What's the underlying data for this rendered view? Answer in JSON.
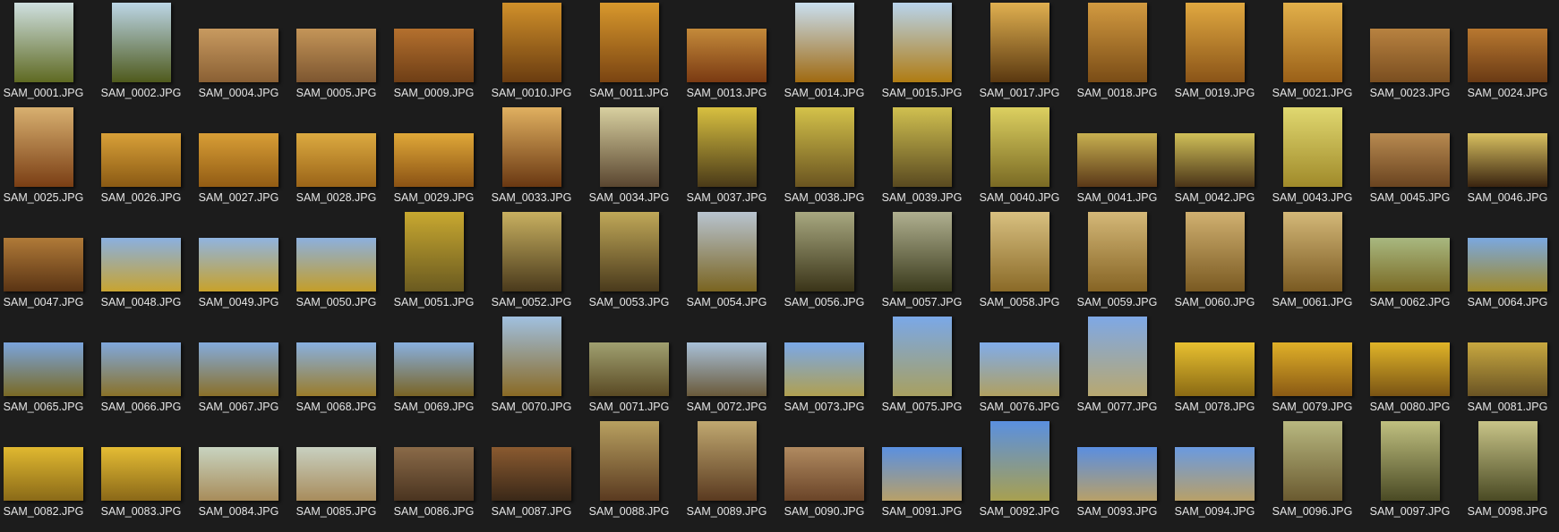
{
  "files": [
    [
      "SAM_0001.JPG",
      "p",
      "#cfe0e0",
      "#5f6a22"
    ],
    [
      "SAM_0002.JPG",
      "p",
      "#bcd6e6",
      "#4f5a1c"
    ],
    [
      "SAM_0004.JPG",
      "l",
      "#c89a60",
      "#8a6034"
    ],
    [
      "SAM_0005.JPG",
      "l",
      "#c49558",
      "#7d5630"
    ],
    [
      "SAM_0009.JPG",
      "l",
      "#b4702e",
      "#6e3e16"
    ],
    [
      "SAM_0010.JPG",
      "p",
      "#d0902a",
      "#6a3c10"
    ],
    [
      "SAM_0011.JPG",
      "p",
      "#d8982c",
      "#7a4412"
    ],
    [
      "SAM_0013.JPG",
      "l",
      "#c48a3a",
      "#7a3a12"
    ],
    [
      "SAM_0014.JPG",
      "p",
      "#c9dff0",
      "#a06a10"
    ],
    [
      "SAM_0015.JPG",
      "p",
      "#b8d4ec",
      "#b07c12"
    ],
    [
      "SAM_0017.JPG",
      "p",
      "#e0b050",
      "#5a3810"
    ],
    [
      "SAM_0018.JPG",
      "p",
      "#d29a40",
      "#7a4c16"
    ],
    [
      "SAM_0019.JPG",
      "p",
      "#e0a840",
      "#8a5418"
    ],
    [
      "SAM_0021.JPG",
      "p",
      "#e2b04a",
      "#9a6018"
    ],
    [
      "SAM_0023.JPG",
      "l",
      "#b88240",
      "#7a4e20"
    ],
    [
      "SAM_0024.JPG",
      "l",
      "#b87830",
      "#6a3a14"
    ],
    [
      "SAM_0025.JPG",
      "p",
      "#d8b070",
      "#7a3e14"
    ],
    [
      "SAM_0026.JPG",
      "l",
      "#d8a038",
      "#8a5a14"
    ],
    [
      "SAM_0027.JPG",
      "l",
      "#d89e36",
      "#925c14"
    ],
    [
      "SAM_0028.JPG",
      "l",
      "#dcaa40",
      "#9a6418"
    ],
    [
      "SAM_0029.JPG",
      "l",
      "#e0a838",
      "#8a5214"
    ],
    [
      "SAM_0033.JPG",
      "p",
      "#e0b060",
      "#6a3812"
    ],
    [
      "SAM_0034.JPG",
      "p",
      "#d8d0a0",
      "#5a4630"
    ],
    [
      "SAM_0037.JPG",
      "p",
      "#d8c040",
      "#4a3a18"
    ],
    [
      "SAM_0038.JPG",
      "p",
      "#d4c24a",
      "#6a5420"
    ],
    [
      "SAM_0039.JPG",
      "p",
      "#d0c050",
      "#5a4a20"
    ],
    [
      "SAM_0040.JPG",
      "p",
      "#dcd060",
      "#7a6a24"
    ],
    [
      "SAM_0041.JPG",
      "l",
      "#c8b050",
      "#5a3818"
    ],
    [
      "SAM_0042.JPG",
      "l",
      "#d0c058",
      "#4a3418"
    ],
    [
      "SAM_0043.JPG",
      "p",
      "#e0d870",
      "#a08a2a"
    ],
    [
      "SAM_0045.JPG",
      "l",
      "#b88a50",
      "#6a4420"
    ],
    [
      "SAM_0046.JPG",
      "l",
      "#d8c060",
      "#3a2410"
    ],
    [
      "SAM_0047.JPG",
      "l",
      "#b07a38",
      "#5a3414"
    ],
    [
      "SAM_0048.JPG",
      "l",
      "#8ab0e0",
      "#c8a430"
    ],
    [
      "SAM_0049.JPG",
      "l",
      "#90b4e0",
      "#c8a22a"
    ],
    [
      "SAM_0050.JPG",
      "l",
      "#8cb0de",
      "#c49e28"
    ],
    [
      "SAM_0051.JPG",
      "p",
      "#c8a830",
      "#6a5a20"
    ],
    [
      "SAM_0052.JPG",
      "p",
      "#c8b060",
      "#4a3a1c"
    ],
    [
      "SAM_0053.JPG",
      "p",
      "#c0a858",
      "#4a3a1c"
    ],
    [
      "SAM_0054.JPG",
      "p",
      "#b8c4d0",
      "#7a6420"
    ],
    [
      "SAM_0056.JPG",
      "p",
      "#a8a880",
      "#3a3418"
    ],
    [
      "SAM_0057.JPG",
      "p",
      "#b0b090",
      "#3a3a1c"
    ],
    [
      "SAM_0058.JPG",
      "p",
      "#d8c080",
      "#8a6a28"
    ],
    [
      "SAM_0059.JPG",
      "p",
      "#d4b878",
      "#866424"
    ],
    [
      "SAM_0060.JPG",
      "p",
      "#d0b070",
      "#7a5a22"
    ],
    [
      "SAM_0061.JPG",
      "p",
      "#d4b878",
      "#7a5a22"
    ],
    [
      "SAM_0062.JPG",
      "l",
      "#a8b880",
      "#7a6a24"
    ],
    [
      "SAM_0064.JPG",
      "l",
      "#7aa8e0",
      "#a08a2a"
    ],
    [
      "SAM_0065.JPG",
      "l",
      "#7aa4dc",
      "#7a6a24"
    ],
    [
      "SAM_0066.JPG",
      "l",
      "#80a8dc",
      "#8a7228"
    ],
    [
      "SAM_0067.JPG",
      "l",
      "#84acdc",
      "#8a7028"
    ],
    [
      "SAM_0068.JPG",
      "l",
      "#88b0e0",
      "#9a7c2a"
    ],
    [
      "SAM_0069.JPG",
      "l",
      "#88b0e0",
      "#7a6424"
    ],
    [
      "SAM_0070.JPG",
      "p",
      "#a0c0e0",
      "#8a6a24"
    ],
    [
      "SAM_0071.JPG",
      "l",
      "#a0a070",
      "#5a4a24"
    ],
    [
      "SAM_0072.JPG",
      "l",
      "#a8c0d8",
      "#6a5a3a"
    ],
    [
      "SAM_0073.JPG",
      "l",
      "#7aa8e8",
      "#b0a050"
    ],
    [
      "SAM_0075.JPG",
      "p",
      "#7aa8e8",
      "#a8a060"
    ],
    [
      "SAM_0076.JPG",
      "l",
      "#80acea",
      "#b0a060"
    ],
    [
      "SAM_0077.JPG",
      "p",
      "#7ea8e6",
      "#b8a870"
    ],
    [
      "SAM_0078.JPG",
      "l",
      "#e8c030",
      "#8a6a14"
    ],
    [
      "SAM_0079.JPG",
      "l",
      "#e0b028",
      "#8a5a14"
    ],
    [
      "SAM_0080.JPG",
      "l",
      "#e0b428",
      "#7a5414"
    ],
    [
      "SAM_0081.JPG",
      "l",
      "#c8a840",
      "#6a5424"
    ],
    [
      "SAM_0082.JPG",
      "l",
      "#e0b830",
      "#8a6a18"
    ],
    [
      "SAM_0083.JPG",
      "l",
      "#e4bc34",
      "#8a6818"
    ],
    [
      "SAM_0084.JPG",
      "l",
      "#c8d4c0",
      "#a88c5a"
    ],
    [
      "SAM_0085.JPG",
      "l",
      "#c8d0c0",
      "#a88c5c"
    ],
    [
      "SAM_0086.JPG",
      "l",
      "#8a6a48",
      "#4a3420"
    ],
    [
      "SAM_0087.JPG",
      "l",
      "#8a5a30",
      "#3a2818"
    ],
    [
      "SAM_0088.JPG",
      "p",
      "#b8a060",
      "#5a3a20"
    ],
    [
      "SAM_0089.JPG",
      "p",
      "#c0a870",
      "#5a3a20"
    ],
    [
      "SAM_0090.JPG",
      "l",
      "#b08a60",
      "#6a4428"
    ],
    [
      "SAM_0091.JPG",
      "l",
      "#5a90e0",
      "#b8a068"
    ],
    [
      "SAM_0092.JPG",
      "p",
      "#5a90e0",
      "#a8a050"
    ],
    [
      "SAM_0093.JPG",
      "l",
      "#5a8ee0",
      "#b8a068"
    ],
    [
      "SAM_0094.JPG",
      "l",
      "#6a9ae0",
      "#b8a068"
    ],
    [
      "SAM_0096.JPG",
      "p",
      "#b8b880",
      "#6a5a30"
    ],
    [
      "SAM_0097.JPG",
      "p",
      "#c0c080",
      "#4a4a24"
    ],
    [
      "SAM_0098.JPG",
      "p",
      "#c8c488",
      "#4a4a24"
    ]
  ]
}
